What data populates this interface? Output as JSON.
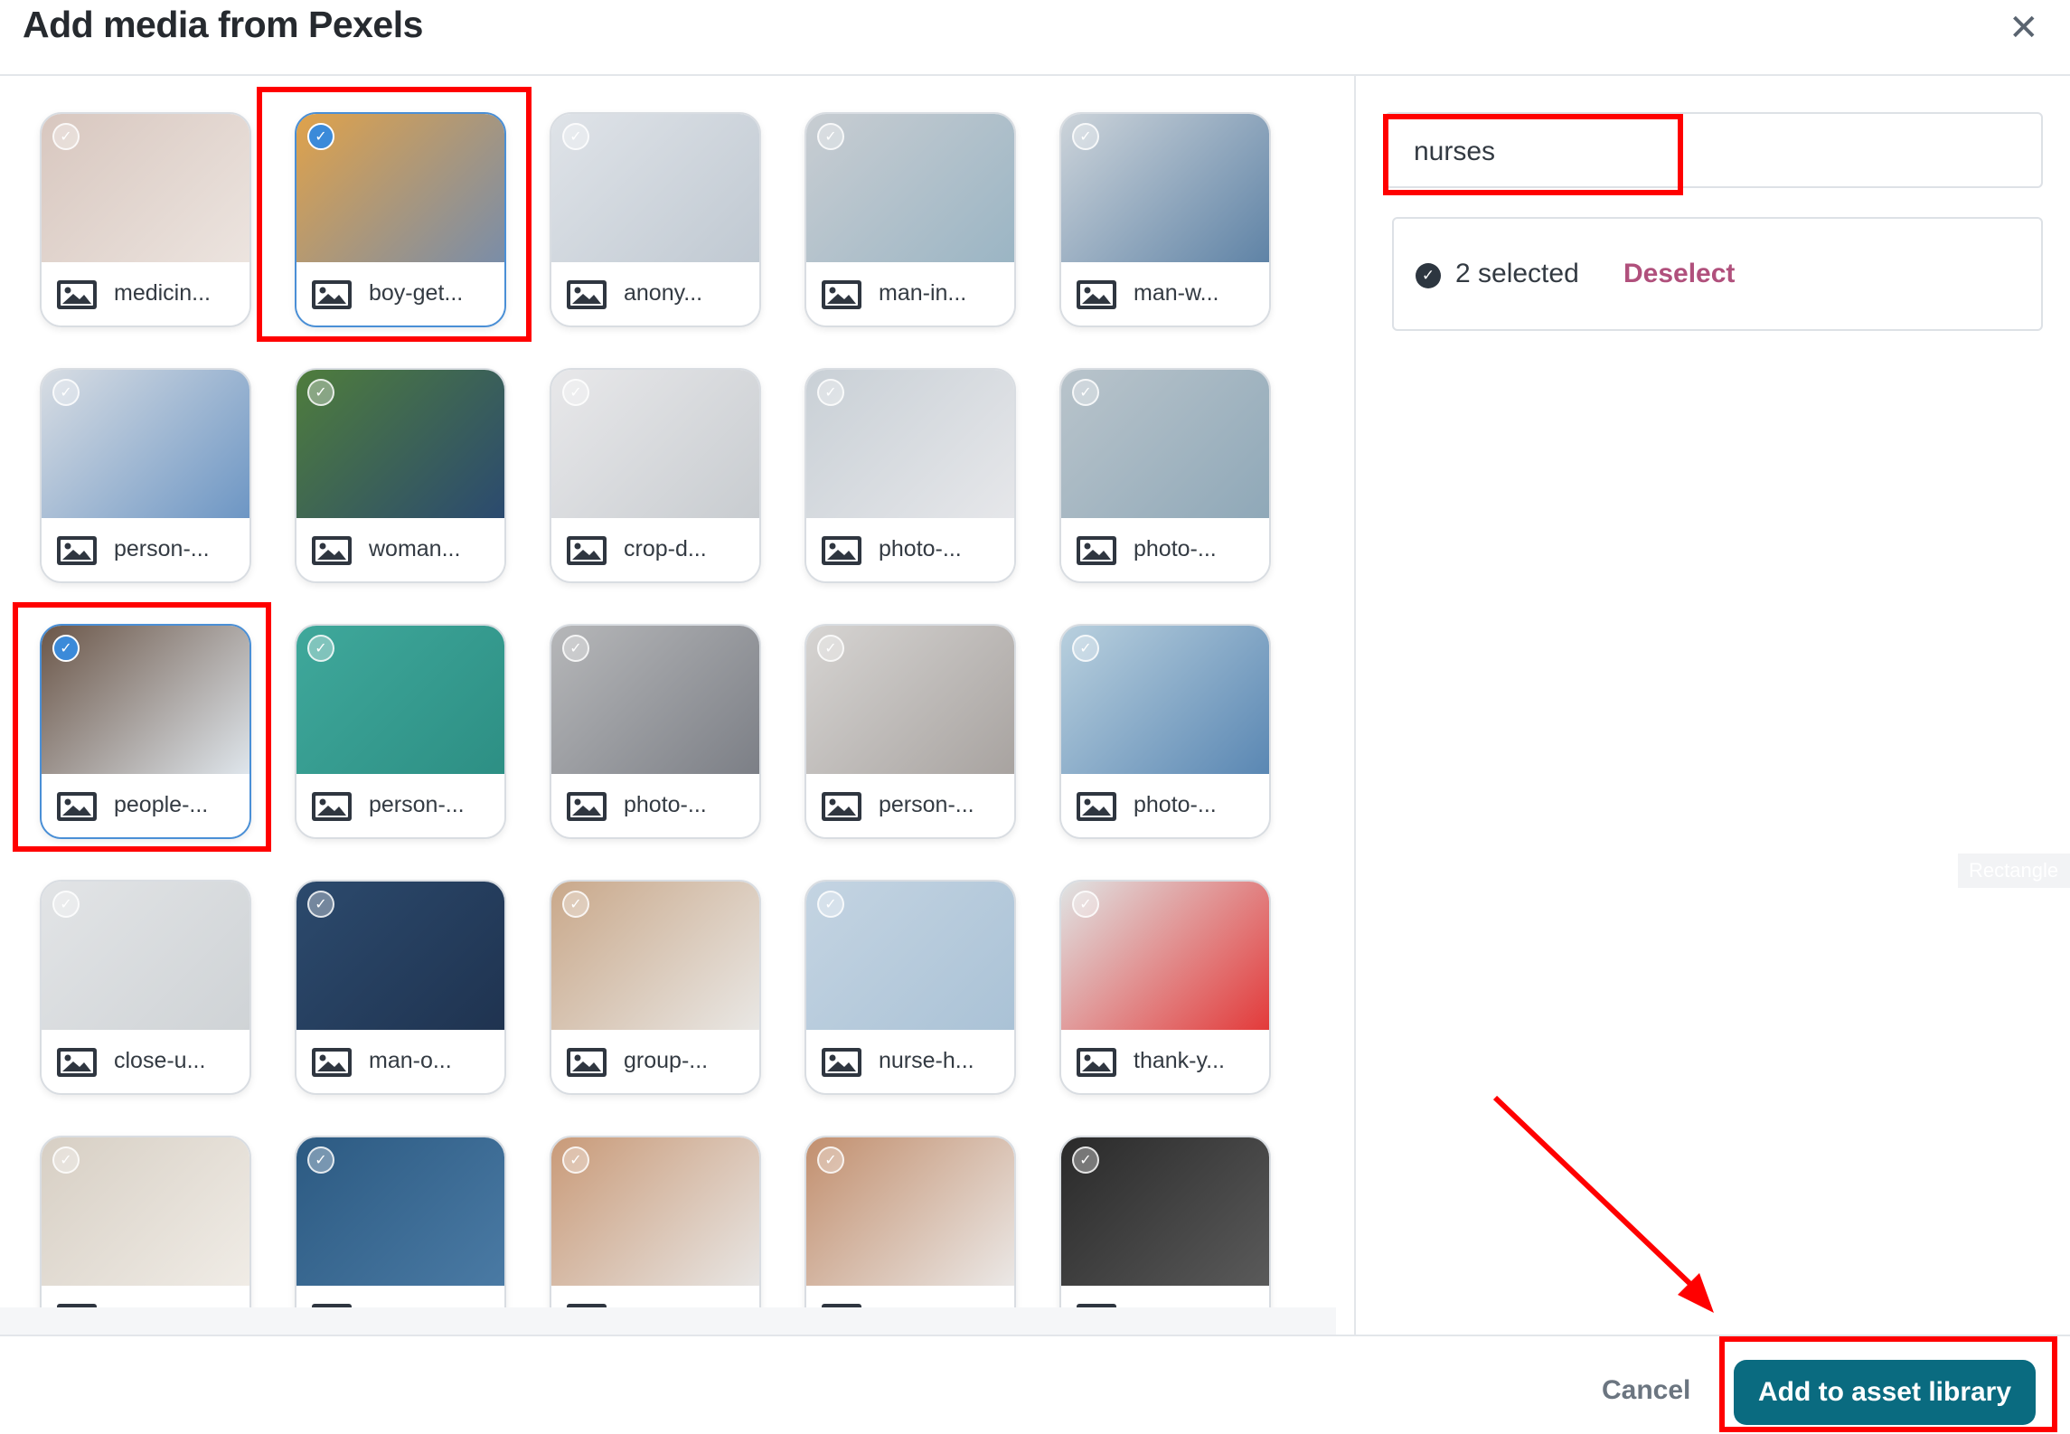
{
  "dialog": {
    "title": "Add media from Pexels",
    "close_icon": "close-icon"
  },
  "search": {
    "value": "nurses"
  },
  "selection": {
    "count_text": "2 selected",
    "deselect_label": "Deselect"
  },
  "tooltip": {
    "text": "Rectangle"
  },
  "footer": {
    "cancel_label": "Cancel",
    "add_label": "Add to asset library"
  },
  "media": [
    {
      "label": "medicin...",
      "selected": false
    },
    {
      "label": "boy-get...",
      "selected": true
    },
    {
      "label": "anony...",
      "selected": false
    },
    {
      "label": "man-in...",
      "selected": false
    },
    {
      "label": "man-w...",
      "selected": false
    },
    {
      "label": "person-...",
      "selected": false
    },
    {
      "label": "woman...",
      "selected": false
    },
    {
      "label": "crop-d...",
      "selected": false
    },
    {
      "label": "photo-...",
      "selected": false
    },
    {
      "label": "photo-...",
      "selected": false
    },
    {
      "label": "people-...",
      "selected": true
    },
    {
      "label": "person-...",
      "selected": false
    },
    {
      "label": "photo-...",
      "selected": false
    },
    {
      "label": "person-...",
      "selected": false
    },
    {
      "label": "photo-...",
      "selected": false
    },
    {
      "label": "close-u...",
      "selected": false
    },
    {
      "label": "man-o...",
      "selected": false
    },
    {
      "label": "group-...",
      "selected": false
    },
    {
      "label": "nurse-h...",
      "selected": false
    },
    {
      "label": "thank-y...",
      "selected": false
    },
    {
      "label": "",
      "selected": false
    },
    {
      "label": "",
      "selected": false
    },
    {
      "label": "",
      "selected": false
    },
    {
      "label": "",
      "selected": false
    },
    {
      "label": "",
      "selected": false
    }
  ],
  "colors": {
    "accent": "#0a6b80",
    "deselect": "#b0507c",
    "selected_border": "#4a8fd6",
    "annotation": "#ff0000"
  }
}
